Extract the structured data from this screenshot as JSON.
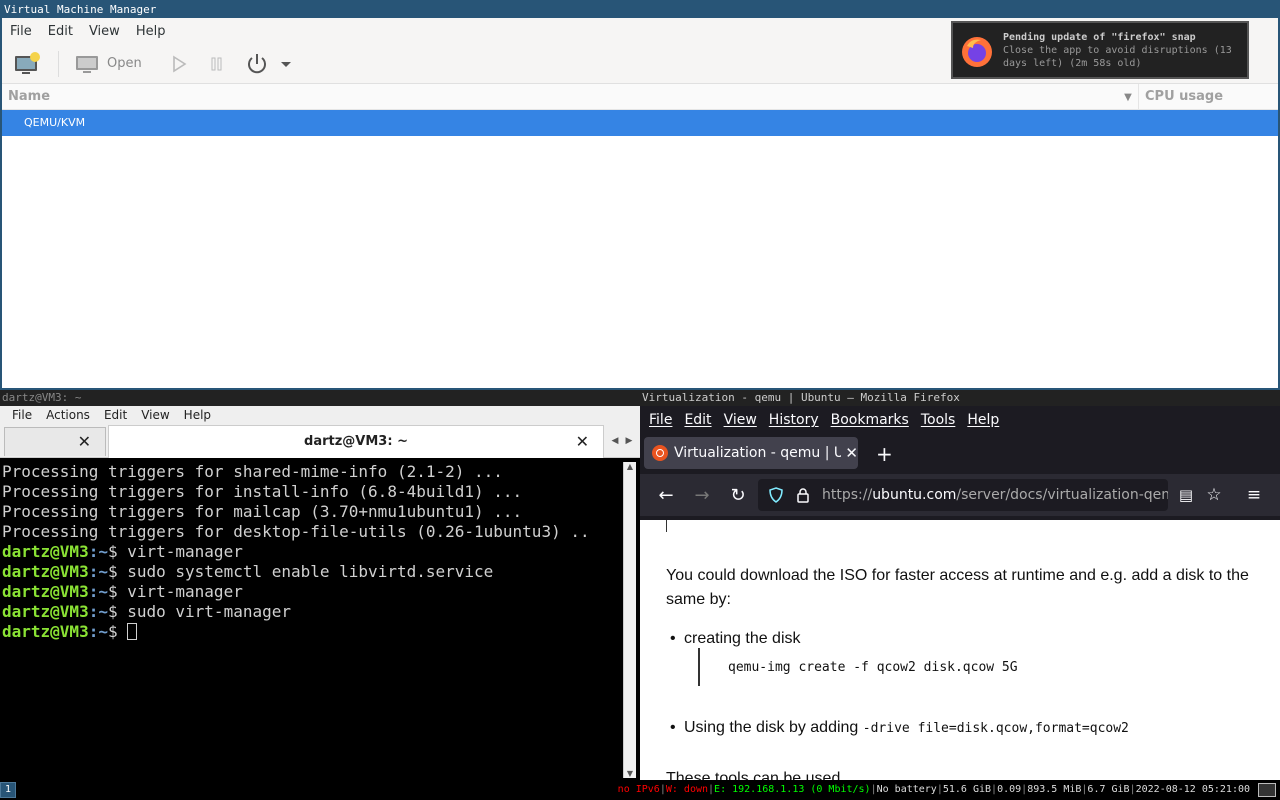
{
  "vmm": {
    "title": "Virtual Machine Manager",
    "menu": [
      "File",
      "Edit",
      "View",
      "Help"
    ],
    "toolbar": {
      "open_label": "Open"
    },
    "columns": {
      "name": "Name",
      "cpu": "CPU usage"
    },
    "rows": [
      "QEMU/KVM"
    ]
  },
  "notification": {
    "title": "Pending update of \"firefox\" snap",
    "body1": "Close the app to avoid disruptions (13",
    "body2": "days left) (2m 58s old)"
  },
  "terminal": {
    "title": "dartz@VM3: ~",
    "menu": [
      "File",
      "Actions",
      "Edit",
      "View",
      "Help"
    ],
    "tab_title": "dartz@VM3: ~",
    "output": [
      "Processing triggers for shared-mime-info (2.1-2) ...",
      "Processing triggers for install-info (6.8-4build1) ...",
      "Processing triggers for mailcap (3.70+nmu1ubuntu1) ...",
      "Processing triggers for desktop-file-utils (0.26-1ubuntu3) .."
    ],
    "prompt_user": "dartz@VM3",
    "prompt_path": ":~",
    "prompt_sign": "$ ",
    "commands": [
      "virt-manager",
      "sudo systemctl enable libvirtd.service",
      "virt-manager",
      "sudo virt-manager"
    ]
  },
  "firefox": {
    "title": "Virtualization - qemu | Ubuntu — Mozilla Firefox",
    "menu": [
      "File",
      "Edit",
      "View",
      "History",
      "Bookmarks",
      "Tools",
      "Help"
    ],
    "tab_label": "Virtualization - qemu | Ub",
    "url_prefix": "https://",
    "url_host": "ubuntu.com",
    "url_path": "/server/docs/virtualization-qemu",
    "para": "You could download the ISO for faster access at runtime and e.g. add a disk to the same by:",
    "bullet1": "creating the disk",
    "code1": "qemu-img create -f qcow2 disk.qcow 5G",
    "bullet2_text": "Using the disk by adding ",
    "bullet2_code": "-drive file=disk.qcow,format=qcow2",
    "cut_text": "These tools can be used…"
  },
  "statusbar": {
    "workspace": "1",
    "ipv6": "no IPv6",
    "wifi": "W: down",
    "eth": "E: 192.168.1.13 (0 Mbit/s)",
    "battery": "No battery",
    "disk": "51.6 GiB",
    "load": "0.09",
    "mem": "893.5 MiB",
    "mem2": "6.7 GiB",
    "datetime": "2022-08-12 05:21:00"
  }
}
